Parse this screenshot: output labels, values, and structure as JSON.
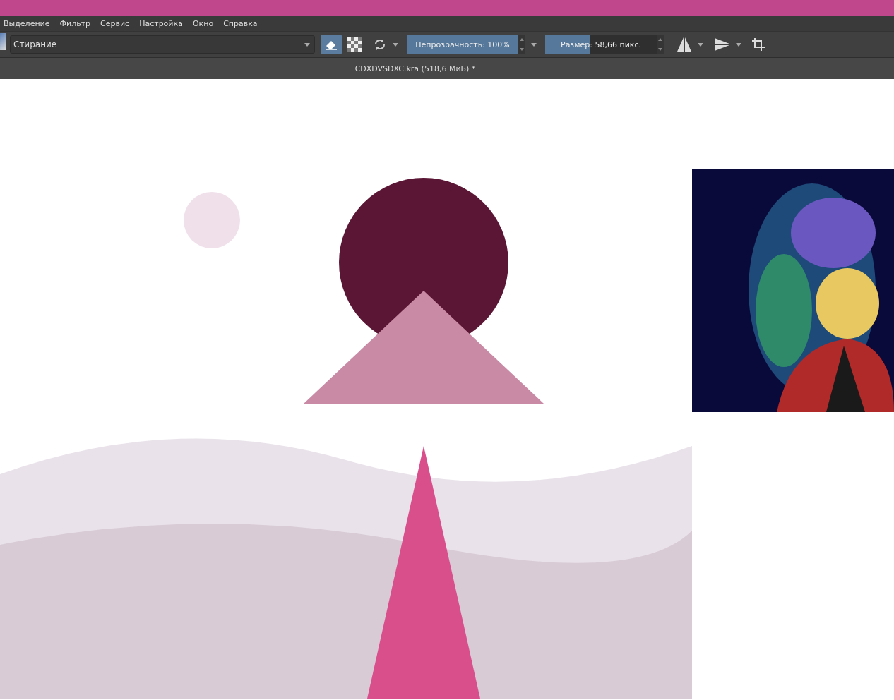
{
  "menu": [
    "Выделение",
    "Фильтр",
    "Сервис",
    "Настройка",
    "Окно",
    "Справка"
  ],
  "toolbar": {
    "preset": "Стирание",
    "eraser_mode": {
      "on": true
    },
    "opacity": {
      "label": "Непрозрачность: 100%",
      "level": 1
    },
    "size": {
      "label": "Размер: 58,66 пикс.",
      "level": 0.4
    }
  },
  "document": {
    "title": "CDXDVSDXC.kra (518,6 МиБ) *"
  }
}
